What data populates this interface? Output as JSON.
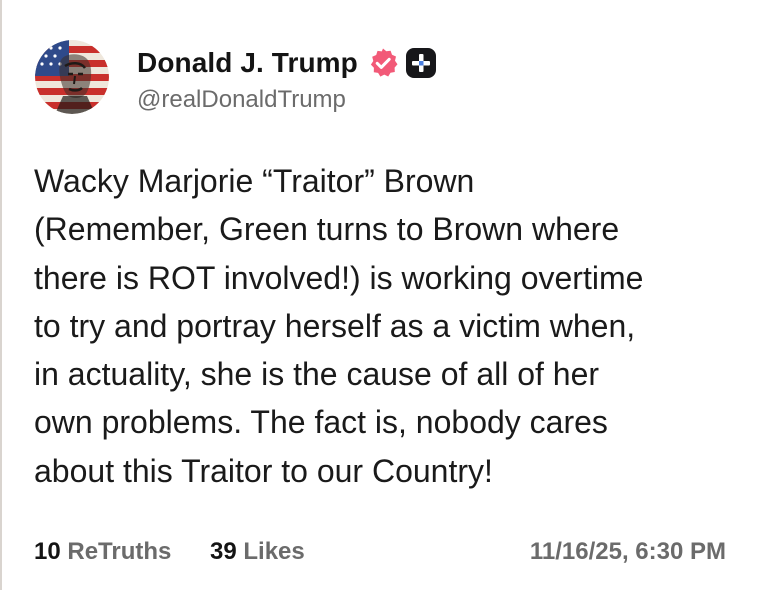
{
  "post": {
    "author": {
      "display_name": "Donald J. Trump",
      "handle": "@realDonaldTrump",
      "avatar_icon": "flag-portrait-avatar",
      "verified_icon": "verified-check-icon",
      "verified_color": "#f25a78",
      "badge_icon": "plus-badge-icon"
    },
    "body_lines": [
      "Wacky Marjorie “Traitor” Brown",
      "(Remember, Green turns to Brown where",
      "there is ROT involved!) is working overtime",
      "to try and portray herself as a victim when,",
      "in actuality, she is the cause of all of her",
      "own problems. The fact is, nobody cares",
      "about this Traitor to our Country!"
    ],
    "stats": {
      "retruths_count": "10",
      "retruths_label": "ReTruths",
      "likes_count": "39",
      "likes_label": "Likes"
    },
    "timestamp": "11/16/25, 6:30 PM"
  }
}
